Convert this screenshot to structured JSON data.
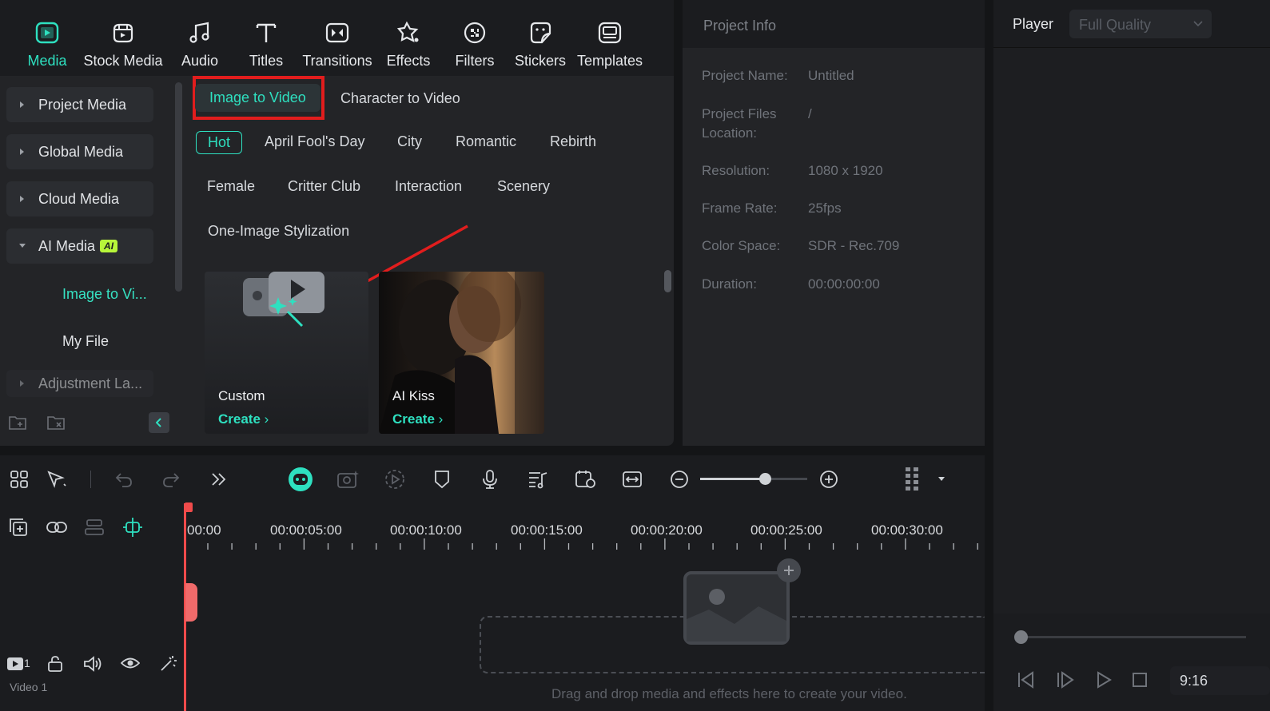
{
  "top_tabs": [
    {
      "label": "Media",
      "icon": "media-icon"
    },
    {
      "label": "Stock Media",
      "icon": "stock-media-icon"
    },
    {
      "label": "Audio",
      "icon": "audio-icon"
    },
    {
      "label": "Titles",
      "icon": "titles-icon"
    },
    {
      "label": "Transitions",
      "icon": "transitions-icon"
    },
    {
      "label": "Effects",
      "icon": "effects-icon"
    },
    {
      "label": "Filters",
      "icon": "filters-icon"
    },
    {
      "label": "Stickers",
      "icon": "stickers-icon"
    },
    {
      "label": "Templates",
      "icon": "templates-icon"
    }
  ],
  "sidebar": {
    "items": [
      {
        "label": "Project Media"
      },
      {
        "label": "Global Media"
      },
      {
        "label": "Cloud Media"
      },
      {
        "label": "AI Media",
        "badge": "AI"
      },
      {
        "label": "Image to Vi..."
      },
      {
        "label": "My File"
      },
      {
        "label": "Adjustment La..."
      }
    ]
  },
  "content": {
    "mode_tabs": [
      "Image to Video",
      "Character to Video"
    ],
    "categories": [
      "Hot",
      "April Fool's Day",
      "City",
      "Romantic",
      "Rebirth",
      "Female",
      "Critter Club",
      "Interaction",
      "Scenery",
      "One-Image Stylization"
    ],
    "cards": [
      {
        "title": "Custom",
        "action": "Create"
      },
      {
        "title": "AI Kiss",
        "action": "Create"
      }
    ]
  },
  "project_info": {
    "title": "Project Info",
    "rows": [
      {
        "label": "Project Name:",
        "value": "Untitled"
      },
      {
        "label": "Project Files Location:",
        "value": "/"
      },
      {
        "label": "Resolution:",
        "value": "1080 x 1920"
      },
      {
        "label": "Frame Rate:",
        "value": "25fps"
      },
      {
        "label": "Color Space:",
        "value": "SDR - Rec.709"
      },
      {
        "label": "Duration:",
        "value": "00:00:00:00"
      }
    ]
  },
  "player": {
    "label": "Player",
    "quality": "Full Quality",
    "aspect": "9:16"
  },
  "timeline": {
    "ticks": [
      "00:00",
      "00:00:05:00",
      "00:00:10:00",
      "00:00:15:00",
      "00:00:20:00",
      "00:00:25:00",
      "00:00:30:00"
    ],
    "track_name": "Video 1",
    "track_number": "1",
    "drop_hint": "Drag and drop media and effects here to create your video."
  },
  "colors": {
    "accent": "#2ee0c0",
    "highlight_box": "#e11d1d",
    "playhead": "#f04b4b"
  }
}
